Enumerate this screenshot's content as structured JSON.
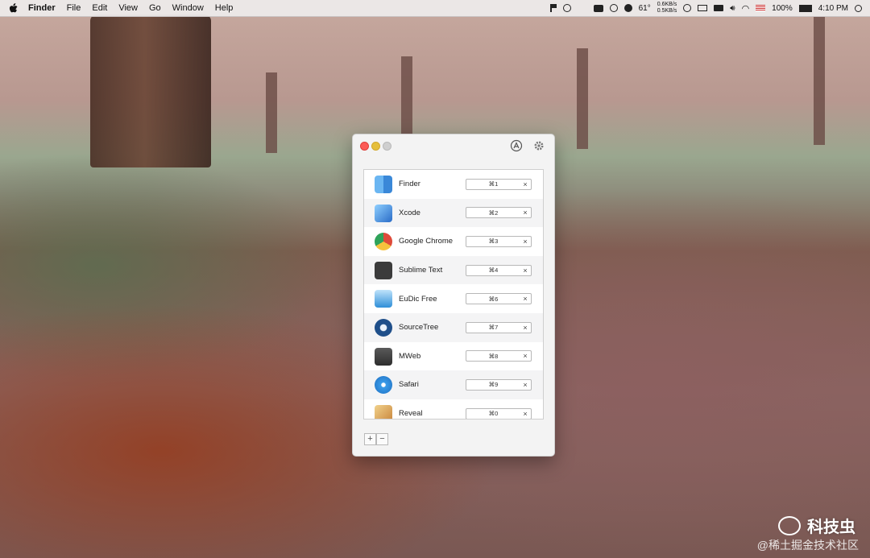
{
  "menubar": {
    "app_name": "Finder",
    "items": [
      "File",
      "Edit",
      "View",
      "Go",
      "Window",
      "Help"
    ],
    "status": {
      "temperature": "61°",
      "net_up": "0.6KB/s",
      "net_down": "0.5KB/s",
      "battery": "100%",
      "time": "4:10 PM"
    }
  },
  "window": {
    "apps": [
      {
        "name": "Finder",
        "shortcut": "⌘1",
        "icon": "finder-icon",
        "color": "#3d8fe0"
      },
      {
        "name": "Xcode",
        "shortcut": "⌘2",
        "icon": "xcode-icon",
        "color": "#2e7bd3"
      },
      {
        "name": "Google Chrome",
        "shortcut": "⌘3",
        "icon": "chrome-icon",
        "color": "#de4a3a"
      },
      {
        "name": "Sublime Text",
        "shortcut": "⌘4",
        "icon": "sublime-icon",
        "color": "#3b3b3b"
      },
      {
        "name": "EuDic Free",
        "shortcut": "⌘6",
        "icon": "eudic-icon",
        "color": "#2f8fd8"
      },
      {
        "name": "SourceTree",
        "shortcut": "⌘7",
        "icon": "sourcetree-icon",
        "color": "#1f4f8a"
      },
      {
        "name": "MWeb",
        "shortcut": "⌘8",
        "icon": "mweb-icon",
        "color": "#4a4a4a"
      },
      {
        "name": "Safari",
        "shortcut": "⌘9",
        "icon": "safari-icon",
        "color": "#3a9be8"
      },
      {
        "name": "Reveal",
        "shortcut": "⌘0",
        "icon": "reveal-icon",
        "color": "#d9a54a"
      }
    ],
    "clear_label": "×",
    "add_label": "+",
    "remove_label": "−"
  },
  "watermark": {
    "brand": "科技虫",
    "subtitle": "@稀土掘金技术社区"
  }
}
